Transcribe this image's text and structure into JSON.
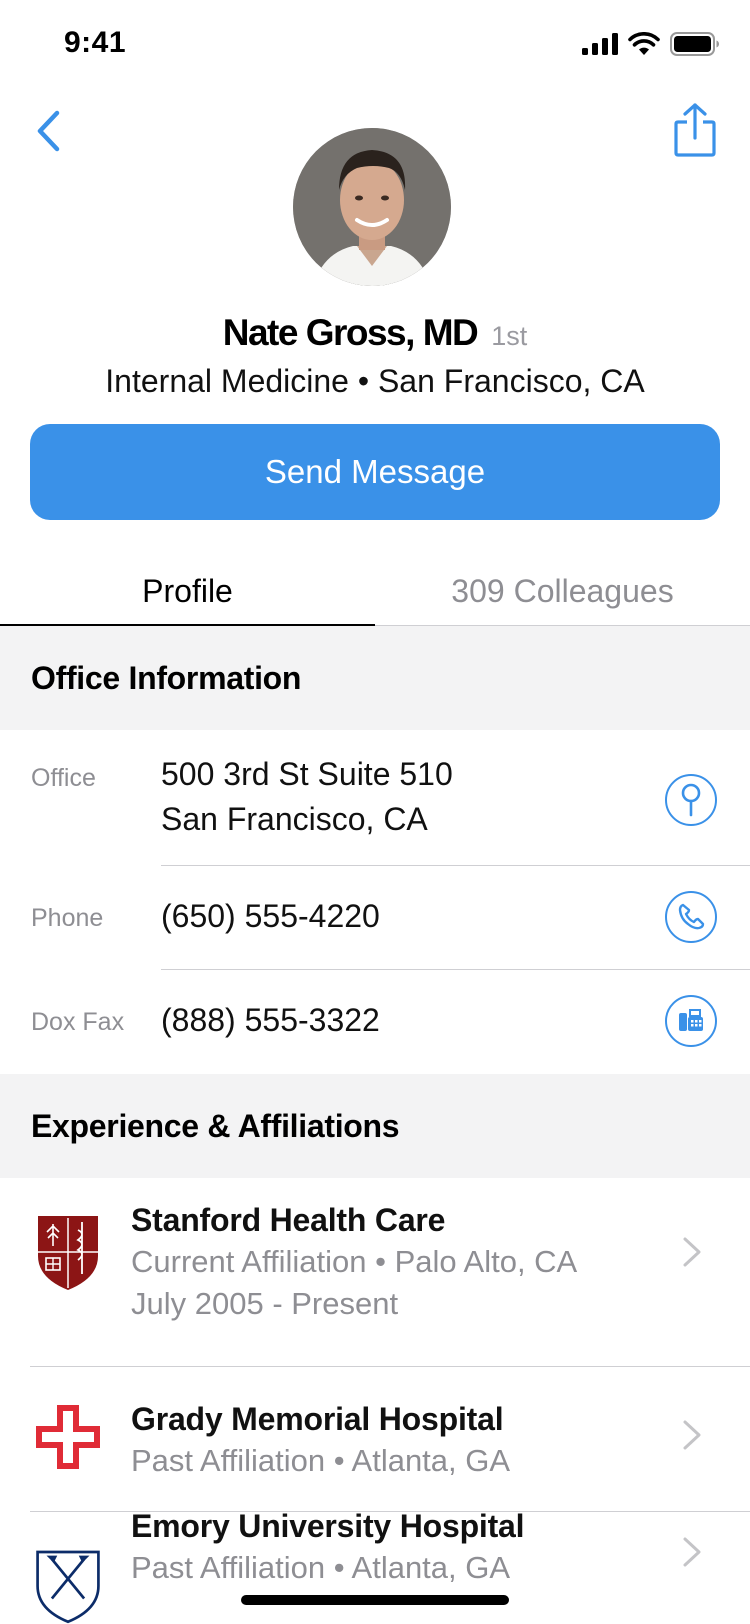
{
  "status_bar": {
    "time": "9:41"
  },
  "profile": {
    "name": "Nate Gross, MD",
    "connection_degree": "1st",
    "subtitle": "Internal Medicine • San Francisco, CA",
    "send_message_label": "Send Message"
  },
  "tabs": [
    {
      "label": "Profile",
      "active": true
    },
    {
      "label": "309 Colleagues",
      "active": false
    }
  ],
  "office_section": {
    "title": "Office Information",
    "rows": [
      {
        "label": "Office",
        "line1": "500 3rd St Suite 510",
        "line2": "San Francisco, CA",
        "icon": "map-pin-icon"
      },
      {
        "label": "Phone",
        "line1": "(650) 555-4220",
        "icon": "phone-icon"
      },
      {
        "label": "Dox Fax",
        "line1": "(888) 555-3322",
        "icon": "fax-icon"
      }
    ]
  },
  "experience_section": {
    "title": "Experience & Affiliations",
    "items": [
      {
        "name": "Stanford Health Care",
        "detail": "Current Affiliation • Palo Alto, CA",
        "dates": "July 2005 - Present",
        "logo": "stanford-shield-logo"
      },
      {
        "name": "Grady Memorial Hospital",
        "detail": "Past Affiliation • Atlanta, GA",
        "logo": "red-cross-logo"
      },
      {
        "name": "Emory University Hospital",
        "detail": "Past Affiliation • Atlanta, GA",
        "logo": "emory-shield-logo"
      }
    ]
  },
  "colors": {
    "accent": "#3a91e8",
    "section_bg": "#f3f3f4",
    "secondary_text": "#8e8e93",
    "stanford_red": "#8c1515",
    "grady_red": "#e02b36",
    "emory_blue": "#0c2c69"
  }
}
